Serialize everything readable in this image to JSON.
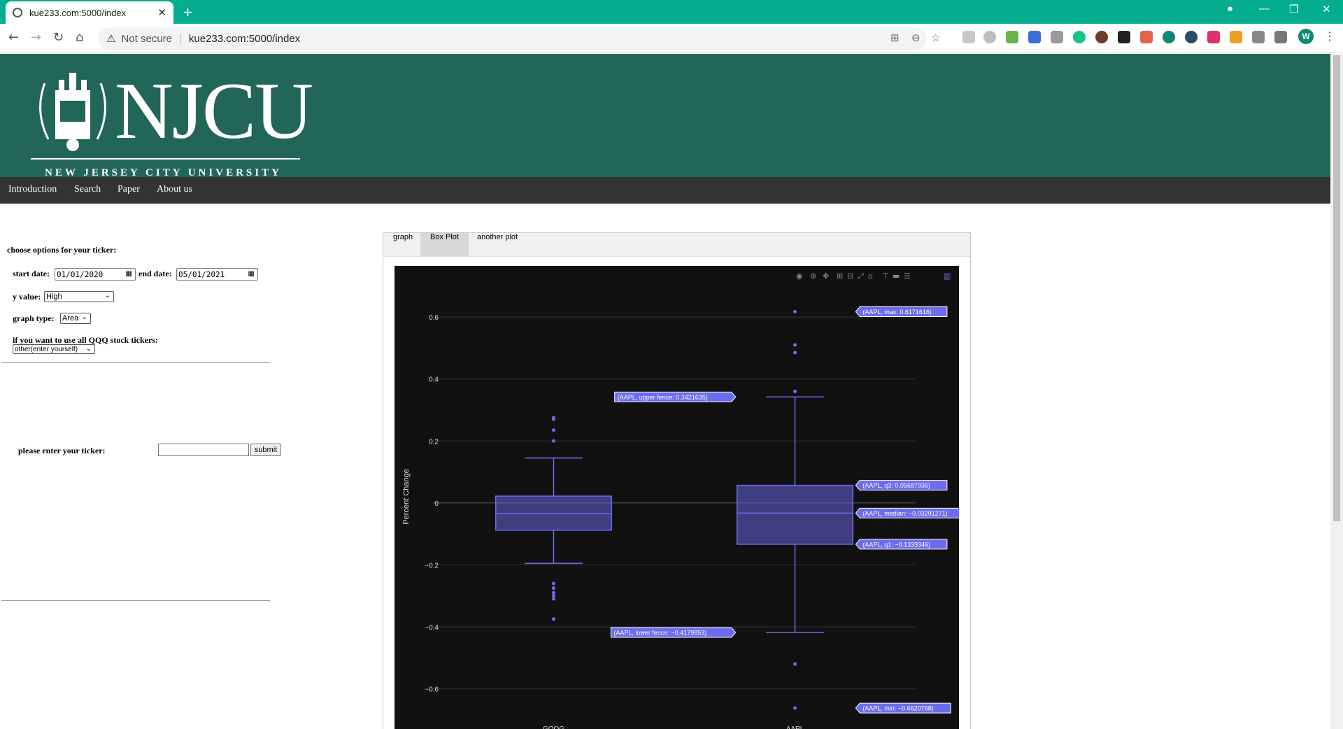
{
  "browser": {
    "tab_title": "kue233.com:5000/index",
    "new_tab": "+",
    "close_tab": "✕",
    "not_secure": "Not secure",
    "url": "kue233.com:5000/index",
    "profile_initial": "W"
  },
  "site": {
    "logo_text": "NJCU",
    "logo_subtitle": "NEW JERSEY CITY UNIVERSITY",
    "nav": [
      "Introduction",
      "Search",
      "Paper",
      "About us"
    ]
  },
  "form": {
    "title": "choose options for your ticker:",
    "start_label": "start date:",
    "start_value": "01/01/2020",
    "end_label": "end date:",
    "end_value": "05/01/2021",
    "y_label": "y value:",
    "y_value": "High",
    "graph_type_label": "graph type:",
    "graph_type_value": "Area",
    "qqq_label": "if you want to use all QQQ stock tickers:",
    "qqq_value": "other(enter yourself)",
    "ticker_label": "please enter your ticker:",
    "ticker_value": "",
    "submit_label": "submit"
  },
  "tabs": [
    "graph",
    "Box Plot",
    "another plot"
  ],
  "active_tab": "Box Plot",
  "chart_data": {
    "type": "box",
    "ylabel": "Percent Change",
    "ylim": [
      -0.68,
      0.72
    ],
    "yticks": [
      0.6,
      0.4,
      0.2,
      0,
      -0.2,
      -0.4,
      -0.6
    ],
    "ytick_labels": [
      "0.6",
      "0.4",
      "0.2",
      "0",
      "−0.2",
      "−0.4",
      "−0.6"
    ],
    "categories": [
      "GOOG",
      "AAPL"
    ],
    "color": "#6c6cf0",
    "boxes": [
      {
        "name": "GOOG",
        "lowerfence": -0.195,
        "q1": -0.088,
        "median": -0.035,
        "q3": 0.022,
        "upperfence": 0.145,
        "outliers": [
          0.275,
          0.27,
          0.235,
          0.2,
          -0.26,
          -0.275,
          -0.29,
          -0.3,
          -0.31,
          -0.375
        ]
      },
      {
        "name": "AAPL",
        "lowerfence": -0.4179853,
        "q1": -0.1333346,
        "median": -0.03291271,
        "q3": 0.05687936,
        "upperfence": 0.3421635,
        "outliers": [
          0.6171616,
          0.51,
          0.485,
          0.36,
          -0.52,
          -0.6620768
        ]
      }
    ],
    "hover_labels": [
      {
        "text": "(AAPL, max: 0.6171616)",
        "y": 0.6171616,
        "side": "right"
      },
      {
        "text": "(AAPL, upper fence: 0.3421635)",
        "y": 0.3421635,
        "side": "left"
      },
      {
        "text": "(AAPL, q3: 0.05687936)",
        "y": 0.05687936,
        "side": "right"
      },
      {
        "text": "(AAPL, median: −0.03291271)",
        "y": -0.03291271,
        "side": "right"
      },
      {
        "text": "(AAPL, q1: −0.1333346)",
        "y": -0.1333346,
        "side": "right"
      },
      {
        "text": "(AAPL, lower fence: −0.4179853)",
        "y": -0.4179853,
        "side": "left"
      },
      {
        "text": "(AAPL, min: −0.6620768)",
        "y": -0.6620768,
        "side": "right"
      }
    ],
    "grid": true,
    "background": "#111111"
  }
}
